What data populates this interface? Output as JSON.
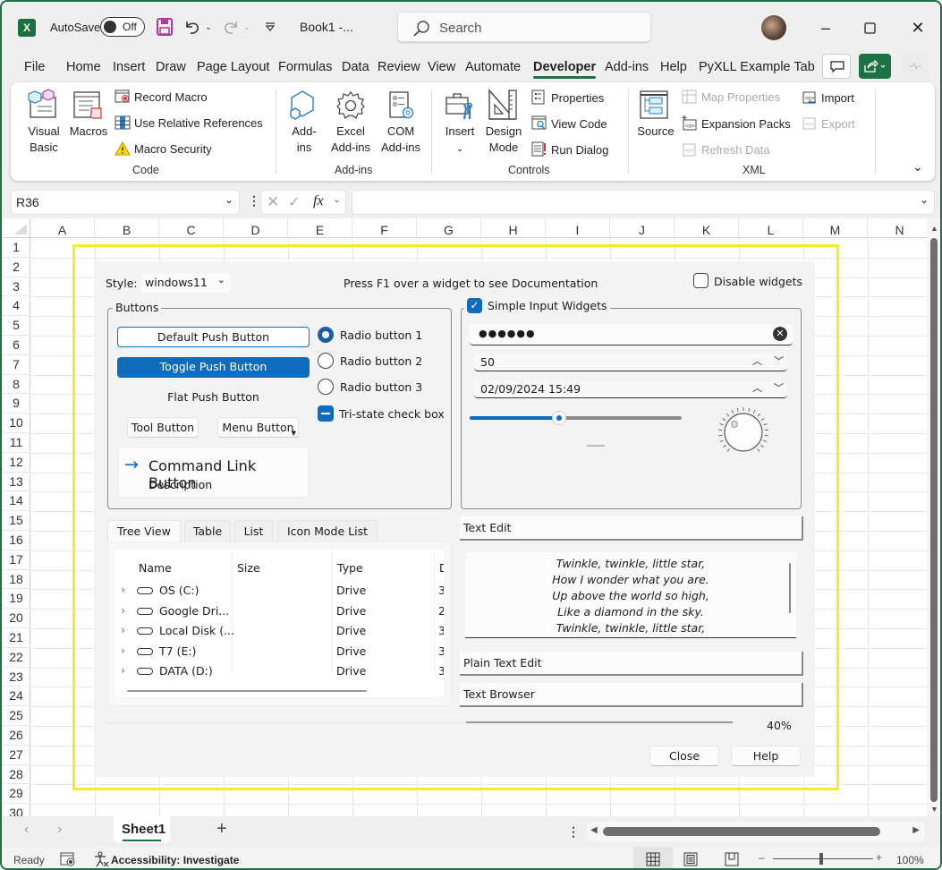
{
  "titlebar": {
    "app_icon": "excel-logo-icon",
    "autosave_label": "AutoSave",
    "autosave_state": "Off",
    "doc_title": "Book1  -...",
    "search_placeholder": "Search",
    "window_buttons": [
      "minimize",
      "maximize",
      "close"
    ]
  },
  "menu": {
    "tabs": [
      "File",
      "Home",
      "Insert",
      "Draw",
      "Page Layout",
      "Formulas",
      "Data",
      "Review",
      "View",
      "Automate",
      "Developer",
      "Add-ins",
      "Help",
      "PyXLL Example Tab"
    ],
    "active": "Developer"
  },
  "ribbon": {
    "code": {
      "label": "Code",
      "visual_basic": "Visual\nBasic",
      "macros": "Macros",
      "record_macro": "Record Macro",
      "relative_refs": "Use Relative References",
      "macro_security": "Macro Security"
    },
    "addins": {
      "label": "Add-ins",
      "addins": "Add-\nins",
      "excel_addins": "Excel\nAdd-ins",
      "com_addins": "COM\nAdd-ins"
    },
    "controls": {
      "label": "Controls",
      "insert": "Insert",
      "design_mode": "Design\nMode",
      "properties": "Properties",
      "view_code": "View Code",
      "run_dialog": "Run Dialog"
    },
    "xml": {
      "label": "XML",
      "source": "Source",
      "map_properties": "Map Properties",
      "expansion_packs": "Expansion Packs",
      "refresh_data": "Refresh Data",
      "import": "Import",
      "export": "Export"
    }
  },
  "formula_bar": {
    "name_box": "R36",
    "formula": ""
  },
  "grid": {
    "columns": [
      "A",
      "B",
      "C",
      "D",
      "E",
      "F",
      "G",
      "H",
      "I",
      "J",
      "K",
      "L",
      "M",
      "N"
    ],
    "rows": [
      "1",
      "2",
      "3",
      "4",
      "5",
      "6",
      "7",
      "8",
      "9",
      "10",
      "11",
      "12",
      "13",
      "14",
      "15",
      "16",
      "17",
      "18",
      "19",
      "20",
      "21",
      "22",
      "23",
      "24",
      "25",
      "26",
      "27",
      "28",
      "29",
      "30"
    ]
  },
  "dialog": {
    "style_label": "Style:",
    "style_value": "windows11",
    "hint": "Press F1 over a widget to see Documentation",
    "disable_widgets": "Disable widgets",
    "buttons_group": {
      "title": "Buttons",
      "default_push": "Default Push Button",
      "toggle_push": "Toggle Push Button",
      "flat_push": "Flat Push Button",
      "tool_button": "Tool Button",
      "menu_button": "Menu Button",
      "command_link": "Command Link Button",
      "command_desc": "Description",
      "radio1": "Radio button 1",
      "radio2": "Radio button 2",
      "radio3": "Radio button 3",
      "tristate": "Tri-state check box",
      "selected_radio": 1
    },
    "simple_inputs": {
      "title": "Simple Input Widgets",
      "checked": true,
      "password": "●●●●●●",
      "spin_value": "50",
      "datetime": "02/09/2024 15:49",
      "slider_value_fraction": 0.42
    },
    "tabs": [
      "Tree View",
      "Table",
      "List",
      "Icon Mode List"
    ],
    "active_tab": "Tree View",
    "tree": {
      "headers": [
        "Name",
        "Size",
        "Type",
        "D"
      ],
      "rows": [
        {
          "name": "OS (C:)",
          "size": "",
          "type": "Drive",
          "d": "3"
        },
        {
          "name": "Google Dri...",
          "size": "",
          "type": "Drive",
          "d": "2"
        },
        {
          "name": "Local Disk (...",
          "size": "",
          "type": "Drive",
          "d": "3"
        },
        {
          "name": "T7 (E:)",
          "size": "",
          "type": "Drive",
          "d": "3"
        },
        {
          "name": "DATA (D:)",
          "size": "",
          "type": "Drive",
          "d": "3"
        }
      ]
    },
    "text_edit": {
      "label": "Text Edit",
      "lines": [
        "Twinkle, twinkle, little star,",
        "How I wonder what you are.",
        "Up above the world so high,",
        "Like a diamond in the sky.",
        "Twinkle, twinkle, little star,"
      ]
    },
    "plain_text_edit": "Plain Text Edit",
    "text_browser": "Text Browser",
    "progress_percent": "40%",
    "progress_value": 40,
    "close": "Close",
    "help": "Help"
  },
  "sheet_tabs": {
    "tabs": [
      "Sheet1"
    ],
    "active": "Sheet1"
  },
  "status": {
    "ready": "Ready",
    "accessibility": "Accessibility: Investigate",
    "zoom": "100%"
  },
  "colors": {
    "excel_green": "#1e7145",
    "accent_blue": "#0f6cbd",
    "highlight_yellow": "#f6ee24"
  }
}
